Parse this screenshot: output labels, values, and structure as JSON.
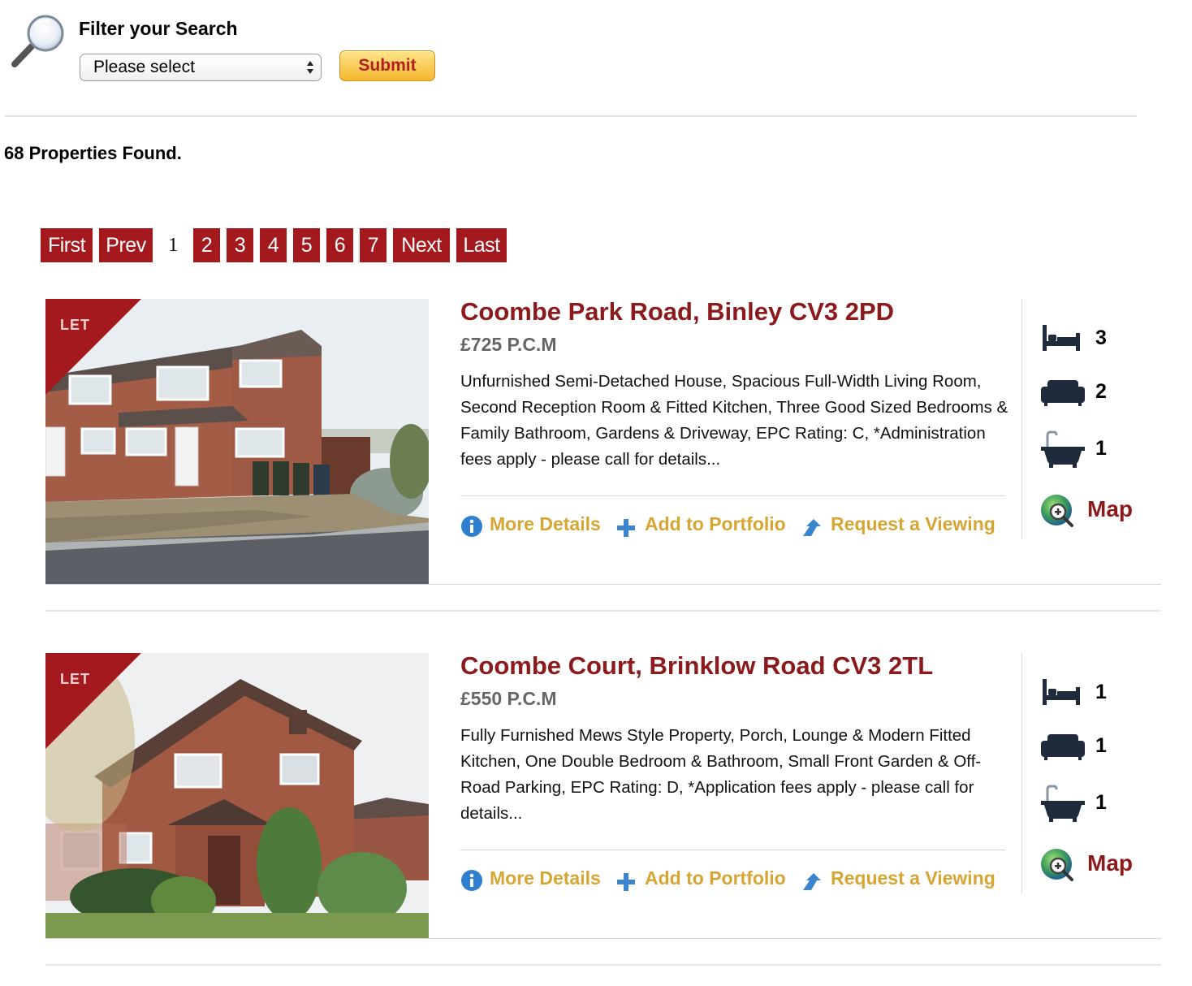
{
  "filter": {
    "title": "Filter your Search",
    "select_value": "Please select",
    "submit_label": "Submit"
  },
  "results": {
    "count_text": "68 Properties Found."
  },
  "pagination": {
    "first": "First",
    "prev": "Prev",
    "pages": [
      "1",
      "2",
      "3",
      "4",
      "5",
      "6",
      "7"
    ],
    "current": "1",
    "next": "Next",
    "last": "Last"
  },
  "listings": [
    {
      "badge": "LET",
      "title": "Coombe Park Road, Binley CV3 2PD",
      "price": "£725 P.C.M",
      "description": "Unfurnished Semi-Detached House, Spacious Full-Width Living Room, Second Reception Room & Fitted Kitchen, Three Good Sized Bedrooms & Family Bathroom, Gardens & Driveway, EPC Rating: C, *Administration fees apply - please call for details...",
      "bedrooms": "3",
      "receptions": "2",
      "bathrooms": "1",
      "more_details": "More Details",
      "add_portfolio": "Add to Portfolio",
      "request_viewing": "Request a Viewing",
      "map": "Map"
    },
    {
      "badge": "LET",
      "title": "Coombe Court, Brinklow Road CV3 2TL",
      "price": "£550 P.C.M",
      "description": "Fully Furnished Mews Style Property, Porch, Lounge & Modern Fitted Kitchen, One Double Bedroom & Bathroom, Small Front Garden & Off-Road Parking, EPC Rating: D, *Application fees apply - please call for details...",
      "bedrooms": "1",
      "receptions": "1",
      "bathrooms": "1",
      "more_details": "More Details",
      "add_portfolio": "Add to Portfolio",
      "request_viewing": "Request a Viewing",
      "map": "Map"
    }
  ],
  "colors": {
    "brand_red": "#a3191d",
    "title_red": "#8b1a1c",
    "action_gold": "#d6a532",
    "price_gray": "#666666"
  },
  "icons": [
    "magnifier-icon",
    "bed-icon",
    "sofa-icon",
    "bath-icon",
    "map-icon",
    "info-icon",
    "plus-icon",
    "arrow-up-icon"
  ]
}
